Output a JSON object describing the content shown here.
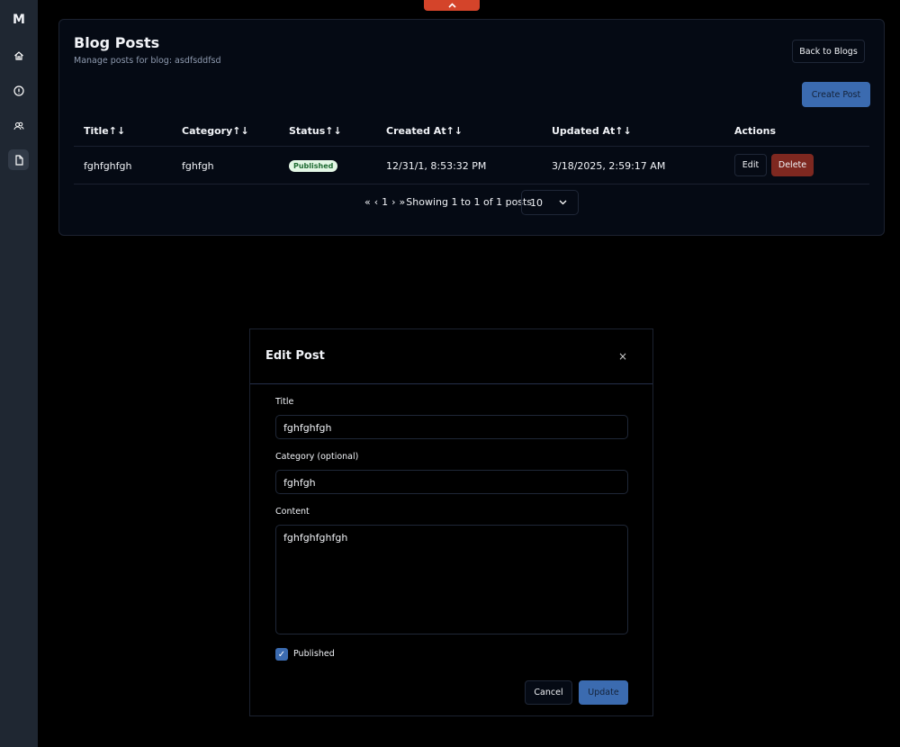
{
  "sidebar": {
    "logo": "M",
    "items": [
      "home",
      "info",
      "users",
      "posts"
    ]
  },
  "header": {
    "title": "Blog Posts",
    "subtitle": "Manage posts for blog: asdfsddfsd",
    "back_label": "Back to Blogs",
    "create_label": "Create Post"
  },
  "table": {
    "columns": [
      "Title↑↓",
      "Category↑↓",
      "Status↑↓",
      "Created At↑↓",
      "Updated At↑↓",
      "Actions"
    ],
    "rows": [
      {
        "title": "fghfghfgh",
        "category": "fghfgh",
        "status": "Published",
        "created": "12/31/1, 8:53:32 PM",
        "updated": "3/18/2025, 2:59:17 AM",
        "edit": "Edit",
        "delete": "Delete"
      }
    ]
  },
  "pagination": {
    "first": "«",
    "prev": "‹",
    "page": "1",
    "next": "›",
    "last": "»",
    "summary": "Showing 1 to 1 of 1 posts",
    "page_size": "10"
  },
  "modal": {
    "title": "Edit Post",
    "close": "×",
    "title_label": "Title",
    "title_value": "fghfghfgh",
    "category_label": "Category (optional)",
    "category_value": "fghfgh",
    "content_label": "Content",
    "content_value": "fghfghfghfgh",
    "published_label": "Published",
    "published": true,
    "cancel": "Cancel",
    "update": "Update"
  }
}
